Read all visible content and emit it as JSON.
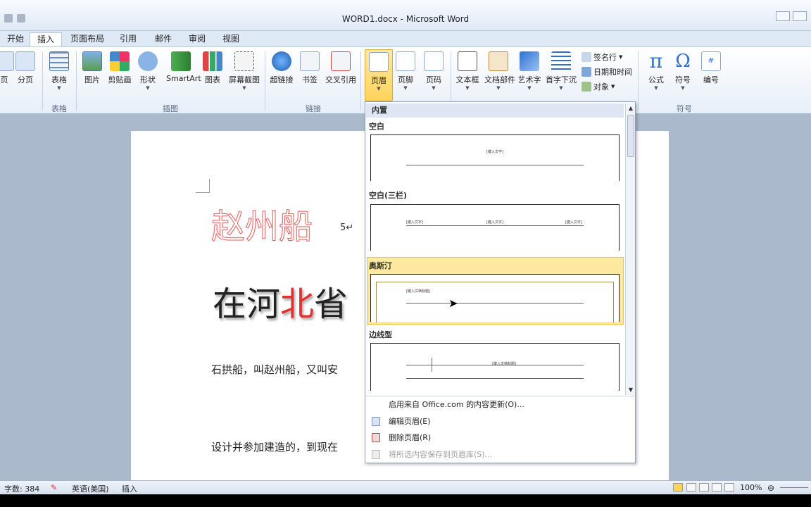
{
  "window": {
    "title": "WORD1.docx - Microsoft Word"
  },
  "tabs": [
    "开始",
    "插入",
    "页面布局",
    "引用",
    "邮件",
    "审阅",
    "视图"
  ],
  "active_tab": "插入",
  "ribbon": {
    "pages": {
      "cut_label": "页",
      "page_break": "分页"
    },
    "tables": {
      "table": "表格",
      "group": "表格"
    },
    "illustrations": {
      "picture": "图片",
      "clipart": "剪贴画",
      "shapes": "形状",
      "smartart": "SmartArt",
      "chart": "图表",
      "screenshot": "屏幕截图",
      "group": "插图"
    },
    "links": {
      "hyperlink": "超链接",
      "bookmark": "书签",
      "crossref": "交叉引用",
      "group": "链接"
    },
    "header_footer": {
      "header": "页眉",
      "footer": "页脚",
      "page_number": "页码"
    },
    "text": {
      "textbox": "文本框",
      "quickparts": "文档部件",
      "wordart": "艺术字",
      "dropcap": "首字下沉",
      "signature": "签名行",
      "datetime": "日期和时间",
      "object": "对象"
    },
    "symbols": {
      "equation": "公式",
      "symbol": "符号",
      "number": "编号",
      "group": "符号"
    }
  },
  "document": {
    "title": "赵州船",
    "mark": "5↵",
    "line1_a": "在河",
    "line1_red": "北",
    "line1_b": "省",
    "para1": "石拱船，叫赵州船，又叫安",
    "para2": "设计并参加建造的，到现在"
  },
  "gallery": {
    "section": "内置",
    "items": [
      {
        "name": "空白",
        "placeholders": [
          "[键入文字]"
        ]
      },
      {
        "name": "空白(三栏)",
        "placeholders": [
          "[键入文字]",
          "[键入文字]",
          "[键入文字]"
        ]
      },
      {
        "name": "奥斯汀",
        "placeholders": [
          "[键入文档标题]"
        ]
      },
      {
        "name": "边线型",
        "placeholders": [
          "[键入文档标题]"
        ]
      }
    ],
    "menu": [
      {
        "label": "启用来自 Office.com 的内容更新(O)...",
        "enabled": true
      },
      {
        "label": "编辑页眉(E)",
        "enabled": true
      },
      {
        "label": "删除页眉(R)",
        "enabled": true
      },
      {
        "label": "将所选内容保存到页眉库(S)...",
        "enabled": false
      }
    ]
  },
  "status": {
    "words": "字数: 384",
    "language": "英语(美国)",
    "mode": "插入",
    "zoom": "100%"
  },
  "colors": {
    "accent": "#ffd35a",
    "ribbon_bg": "#e6eef8",
    "workspace": "#abb9cd"
  },
  "icons": [
    "table-icon",
    "picture-icon",
    "clipart-icon",
    "shapes-icon",
    "smartart-icon",
    "chart-icon",
    "screenshot-icon",
    "hyperlink-icon",
    "bookmark-icon",
    "crossref-icon",
    "header-icon",
    "footer-icon",
    "pagenumber-icon",
    "textbox-icon",
    "quickparts-icon",
    "wordart-icon",
    "dropcap-icon",
    "pi-icon",
    "omega-icon",
    "number-icon"
  ]
}
